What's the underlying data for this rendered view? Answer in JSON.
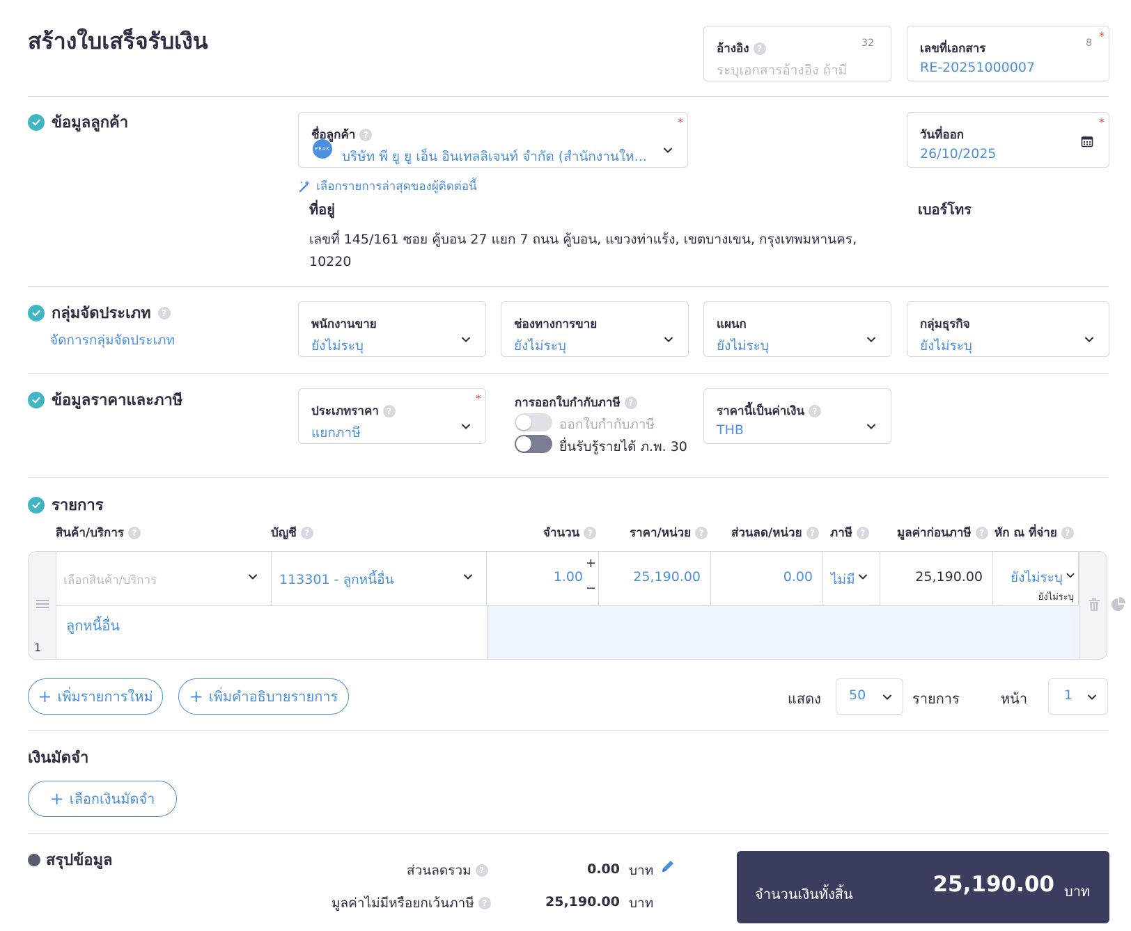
{
  "page": {
    "title": "สร้างใบเสร็จรับเงิน"
  },
  "reference": {
    "label": "อ้างอิง",
    "counter": "32",
    "placeholder": "ระบุเอกสารอ้างอิง ถ้ามี"
  },
  "doc_number": {
    "label": "เลขที่เอกสาร",
    "counter": "8",
    "value": "RE-20251000007"
  },
  "customer_section": {
    "title": "ข้อมูลลูกค้า",
    "name_label": "ชื่อลูกค้า",
    "name_value": "บริษัท พี ยู ยู เอ็น อินเทลลิเจนท์ จำกัด (สำนักงานให...",
    "avatar_text": "PEAK",
    "recent_link": "เลือกรายการล่าสุดของผู้ติดต่อนี้",
    "issue_date_label": "วันที่ออก",
    "issue_date_value": "26/10/2025",
    "address_label": "ที่อยู่",
    "address_line1": "เลขที่ 145/161 ซอย คู้บอน 27 แยก 7 ถนน คู้บอน, แขวงท่าแร้ง, เขตบางเขน, กรุงเทพมหานคร,",
    "address_line2": "10220",
    "phone_label": "เบอร์โทร"
  },
  "classification": {
    "title": "กลุ่มจัดประเภท",
    "manage_link": "จัดการกลุ่มจัดประเภท",
    "fields": [
      {
        "label": "พนักงานขาย",
        "value": "ยังไม่ระบุ"
      },
      {
        "label": "ช่องทางการขาย",
        "value": "ยังไม่ระบุ"
      },
      {
        "label": "แผนก",
        "value": "ยังไม่ระบุ"
      },
      {
        "label": "กลุ่มธุรกิจ",
        "value": "ยังไม่ระบุ"
      }
    ]
  },
  "pricing": {
    "title": "ข้อมูลราคาและภาษี",
    "price_type_label": "ประเภทราคา",
    "price_type_value": "แยกภาษี",
    "tax_invoice_label": "การออกใบกำกับภาษี",
    "toggle1_label": "ออกใบกำกับภาษี",
    "toggle2_label": "ยื่นรับรู้รายได้ ภ.พ. 30",
    "currency_label": "ราคานี้เป็นค่าเงิน",
    "currency_value": "THB"
  },
  "items": {
    "title": "รายการ",
    "headers": {
      "product": "สินค้า/บริการ",
      "account": "บัญชี",
      "qty": "จำนวน",
      "price": "ราคา/หน่วย",
      "discount": "ส่วนลด/หน่วย",
      "tax": "ภาษี",
      "pretax": "มูลค่าก่อนภาษี",
      "withholding": "หัก ณ ที่จ่าย"
    },
    "row": {
      "index": "1",
      "product_placeholder": "เลือกสินค้า/บริการ",
      "account": "113301 - ลูกหนี้อื่น",
      "qty": "1.00",
      "price": "25,190.00",
      "discount": "0.00",
      "tax": "ไม่มี",
      "pretax": "25,190.00",
      "withholding": "ยังไม่ระบุ",
      "withholding_sub": "ยังไม่ระบุ",
      "description": "ลูกหนี้อื่น"
    },
    "add_item": "เพิ่มรายการใหม่",
    "add_description": "เพิ่มคำอธิบายรายการ",
    "show_label": "แสดง",
    "page_size": "50",
    "items_label": "รายการ",
    "page_label": "หน้า",
    "page_value": "1"
  },
  "deposit": {
    "title": "เงินมัดจำ",
    "select_button": "เลือกเงินมัดจำ"
  },
  "summary": {
    "title": "สรุปข้อมูล",
    "discount_label": "ส่วนลดรวม",
    "discount_value": "0.00",
    "nontax_label": "มูลค่าไม่มีหรือยกเว้นภาษี",
    "nontax_value": "25,190.00",
    "currency_unit": "บาท",
    "total_label": "จำนวนเงินทั้งสิ้น",
    "total_value": "25,190.00"
  },
  "colors": {
    "accent": "#4a8fe0",
    "check": "#3fb6c2",
    "total_bg": "#3b3d5e"
  }
}
